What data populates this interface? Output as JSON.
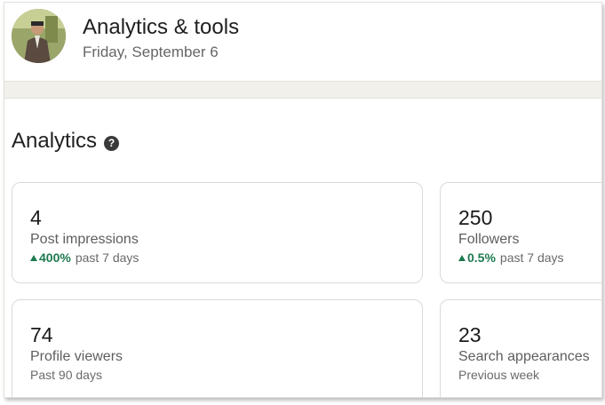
{
  "header": {
    "title": "Analytics & tools",
    "date": "Friday, September 6"
  },
  "analytics": {
    "title": "Analytics",
    "cards": [
      {
        "value": "4",
        "metric": "Post impressions",
        "change": "400%",
        "period": "past 7 days"
      },
      {
        "value": "250",
        "metric": "Followers",
        "change": "0.5%",
        "period": "past 7 days"
      },
      {
        "value": "74",
        "metric": "Profile viewers",
        "period": "Past 90 days"
      },
      {
        "value": "23",
        "metric": "Search appearances",
        "period": "Previous week"
      }
    ]
  },
  "colors": {
    "trend_up": "#1d7a4f",
    "band": "#f2f0eb"
  },
  "icons": {
    "help": "help-icon",
    "trend": "trend-up-icon"
  }
}
